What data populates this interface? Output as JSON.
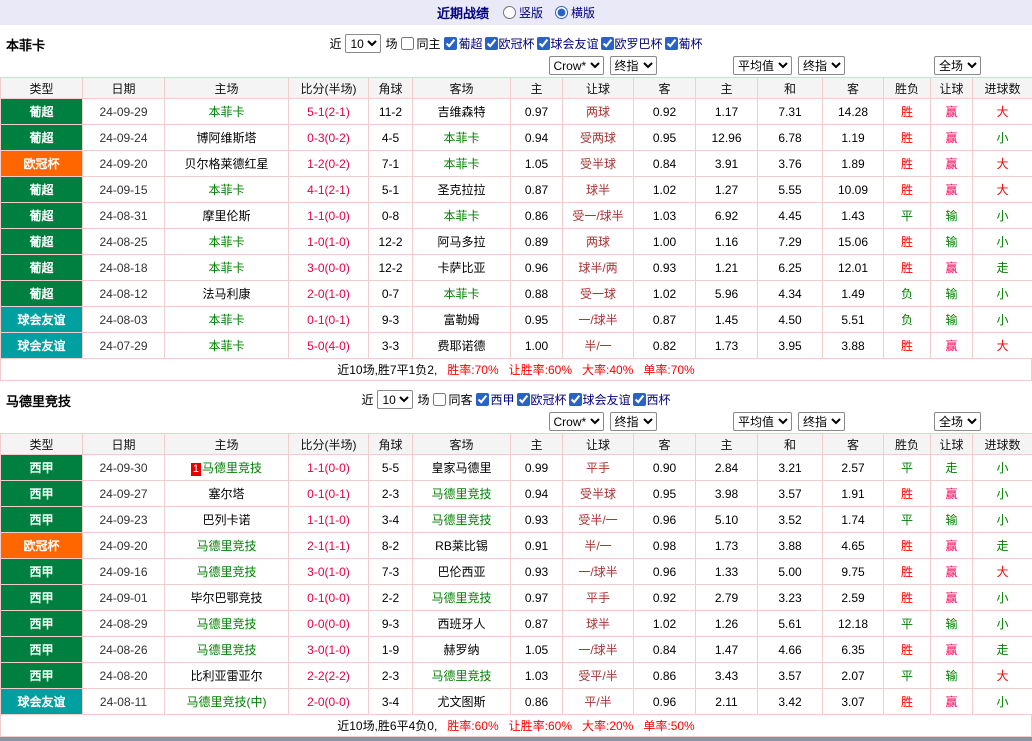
{
  "topbar": {
    "title": "近期战绩",
    "radios": [
      {
        "label": "竖版",
        "selected": false
      },
      {
        "label": "横版",
        "selected": true
      }
    ]
  },
  "colors": {
    "topbar_bg": "#e9e9f8",
    "accent_navy": "#000080",
    "focal_team": "#008000",
    "score": "#e60044",
    "handicap": "#aa3333",
    "border": "#f3cdcd",
    "summary_stat": "#ff0000"
  },
  "league_colors": {
    "葡超": "#008040",
    "欧冠杯": "#ff6600",
    "球会友谊": "#00a0a0",
    "西甲": "#008040"
  },
  "outcome_colors": {
    "胜": "#ff0000",
    "平": "#008000",
    "负": "#008000",
    "赢": "#ff0055",
    "输": "#008000",
    "走": "#008000",
    "大": "#ff0000",
    "小": "#008000"
  },
  "sections": [
    {
      "team": "本菲卡",
      "filter": {
        "near_label": "近",
        "count": "10",
        "games_label": "场",
        "same_label": "同主",
        "leagues": [
          "葡超",
          "欧冠杯",
          "球会友谊",
          "欧罗巴杯",
          "葡杯"
        ]
      },
      "dropdowns": {
        "odds_company": "Crow*",
        "odds_time": "终指",
        "average": "平均值",
        "average_time": "终指",
        "scope": "全场"
      },
      "headers": [
        "类型",
        "日期",
        "主场",
        "比分(半场)",
        "角球",
        "客场",
        "主",
        "让球",
        "客",
        "主",
        "和",
        "客",
        "胜负",
        "让球",
        "进球数"
      ],
      "rows": [
        {
          "league": "葡超",
          "date": "24-09-29",
          "home": "本菲卡",
          "score": "5-1(2-1)",
          "corners": "11-2",
          "away": "吉维森特",
          "focal": "home",
          "odds": [
            "0.97",
            "两球",
            "0.92"
          ],
          "avg": [
            "1.17",
            "7.31",
            "14.28"
          ],
          "outcome": [
            "胜",
            "赢",
            "大"
          ]
        },
        {
          "league": "葡超",
          "date": "24-09-24",
          "home": "博阿维斯塔",
          "score": "0-3(0-2)",
          "corners": "4-5",
          "away": "本菲卡",
          "focal": "away",
          "odds": [
            "0.94",
            "受两球",
            "0.95"
          ],
          "avg": [
            "12.96",
            "6.78",
            "1.19"
          ],
          "outcome": [
            "胜",
            "赢",
            "小"
          ]
        },
        {
          "league": "欧冠杯",
          "date": "24-09-20",
          "home": "贝尔格莱德红星",
          "score": "1-2(0-2)",
          "corners": "7-1",
          "away": "本菲卡",
          "focal": "away",
          "odds": [
            "1.05",
            "受半球",
            "0.84"
          ],
          "avg": [
            "3.91",
            "3.76",
            "1.89"
          ],
          "outcome": [
            "胜",
            "赢",
            "大"
          ]
        },
        {
          "league": "葡超",
          "date": "24-09-15",
          "home": "本菲卡",
          "score": "4-1(2-1)",
          "corners": "5-1",
          "away": "圣克拉拉",
          "focal": "home",
          "odds": [
            "0.87",
            "球半",
            "1.02"
          ],
          "avg": [
            "1.27",
            "5.55",
            "10.09"
          ],
          "outcome": [
            "胜",
            "赢",
            "大"
          ]
        },
        {
          "league": "葡超",
          "date": "24-08-31",
          "home": "摩里伦斯",
          "score": "1-1(0-0)",
          "corners": "0-8",
          "away": "本菲卡",
          "focal": "away",
          "odds": [
            "0.86",
            "受一/球半",
            "1.03"
          ],
          "avg": [
            "6.92",
            "4.45",
            "1.43"
          ],
          "outcome": [
            "平",
            "输",
            "小"
          ]
        },
        {
          "league": "葡超",
          "date": "24-08-25",
          "home": "本菲卡",
          "score": "1-0(1-0)",
          "corners": "12-2",
          "away": "阿马多拉",
          "focal": "home",
          "odds": [
            "0.89",
            "两球",
            "1.00"
          ],
          "avg": [
            "1.16",
            "7.29",
            "15.06"
          ],
          "outcome": [
            "胜",
            "输",
            "小"
          ]
        },
        {
          "league": "葡超",
          "date": "24-08-18",
          "home": "本菲卡",
          "score": "3-0(0-0)",
          "corners": "12-2",
          "away": "卡萨比亚",
          "focal": "home",
          "odds": [
            "0.96",
            "球半/两",
            "0.93"
          ],
          "avg": [
            "1.21",
            "6.25",
            "12.01"
          ],
          "outcome": [
            "胜",
            "赢",
            "走"
          ]
        },
        {
          "league": "葡超",
          "date": "24-08-12",
          "home": "法马利康",
          "score": "2-0(1-0)",
          "corners": "0-7",
          "away": "本菲卡",
          "focal": "away",
          "odds": [
            "0.88",
            "受一球",
            "1.02"
          ],
          "avg": [
            "5.96",
            "4.34",
            "1.49"
          ],
          "outcome": [
            "负",
            "输",
            "小"
          ]
        },
        {
          "league": "球会友谊",
          "date": "24-08-03",
          "home": "本菲卡",
          "score": "0-1(0-1)",
          "corners": "9-3",
          "away": "富勒姆",
          "focal": "home",
          "odds": [
            "0.95",
            "一/球半",
            "0.87"
          ],
          "avg": [
            "1.45",
            "4.50",
            "5.51"
          ],
          "outcome": [
            "负",
            "输",
            "小"
          ]
        },
        {
          "league": "球会友谊",
          "date": "24-07-29",
          "home": "本菲卡",
          "score": "5-0(4-0)",
          "corners": "3-3",
          "away": "费耶诺德",
          "focal": "home",
          "odds": [
            "1.00",
            "半/一",
            "0.82"
          ],
          "avg": [
            "1.73",
            "3.95",
            "3.88"
          ],
          "outcome": [
            "胜",
            "赢",
            "大"
          ]
        }
      ],
      "summary": {
        "prefix": "近10场,胜7平1负2,",
        "stats": [
          "胜率:70%",
          "让胜率:60%",
          "大率:40%",
          "单率:70%"
        ]
      }
    },
    {
      "team": "马德里竞技",
      "filter": {
        "near_label": "近",
        "count": "10",
        "games_label": "场",
        "same_label": "同客",
        "leagues": [
          "西甲",
          "欧冠杯",
          "球会友谊",
          "西杯"
        ]
      },
      "dropdowns": {
        "odds_company": "Crow*",
        "odds_time": "终指",
        "average": "平均值",
        "average_time": "终指",
        "scope": "全场"
      },
      "headers": [
        "类型",
        "日期",
        "主场",
        "比分(半场)",
        "角球",
        "客场",
        "主",
        "让球",
        "客",
        "主",
        "和",
        "客",
        "胜负",
        "让球",
        "进球数"
      ],
      "rows": [
        {
          "league": "西甲",
          "date": "24-09-30",
          "home": "马德里竞技",
          "home_badge": "1",
          "score": "1-1(0-0)",
          "corners": "5-5",
          "away": "皇家马德里",
          "focal": "home",
          "odds": [
            "0.99",
            "平手",
            "0.90"
          ],
          "avg": [
            "2.84",
            "3.21",
            "2.57"
          ],
          "outcome": [
            "平",
            "走",
            "小"
          ]
        },
        {
          "league": "西甲",
          "date": "24-09-27",
          "home": "塞尔塔",
          "score": "0-1(0-1)",
          "corners": "2-3",
          "away": "马德里竞技",
          "focal": "away",
          "odds": [
            "0.94",
            "受半球",
            "0.95"
          ],
          "avg": [
            "3.98",
            "3.57",
            "1.91"
          ],
          "outcome": [
            "胜",
            "赢",
            "小"
          ]
        },
        {
          "league": "西甲",
          "date": "24-09-23",
          "home": "巴列卡诺",
          "score": "1-1(1-0)",
          "corners": "3-4",
          "away": "马德里竞技",
          "focal": "away",
          "odds": [
            "0.93",
            "受半/一",
            "0.96"
          ],
          "avg": [
            "5.10",
            "3.52",
            "1.74"
          ],
          "outcome": [
            "平",
            "输",
            "小"
          ]
        },
        {
          "league": "欧冠杯",
          "date": "24-09-20",
          "home": "马德里竞技",
          "score": "2-1(1-1)",
          "corners": "8-2",
          "away": "RB莱比锡",
          "focal": "home",
          "odds": [
            "0.91",
            "半/一",
            "0.98"
          ],
          "avg": [
            "1.73",
            "3.88",
            "4.65"
          ],
          "outcome": [
            "胜",
            "赢",
            "走"
          ]
        },
        {
          "league": "西甲",
          "date": "24-09-16",
          "home": "马德里竞技",
          "score": "3-0(1-0)",
          "corners": "7-3",
          "away": "巴伦西亚",
          "focal": "home",
          "odds": [
            "0.93",
            "一/球半",
            "0.96"
          ],
          "avg": [
            "1.33",
            "5.00",
            "9.75"
          ],
          "outcome": [
            "胜",
            "赢",
            "大"
          ]
        },
        {
          "league": "西甲",
          "date": "24-09-01",
          "home": "毕尔巴鄂竞技",
          "score": "0-1(0-0)",
          "corners": "2-2",
          "away": "马德里竞技",
          "focal": "away",
          "odds": [
            "0.97",
            "平手",
            "0.92"
          ],
          "avg": [
            "2.79",
            "3.23",
            "2.59"
          ],
          "outcome": [
            "胜",
            "赢",
            "小"
          ]
        },
        {
          "league": "西甲",
          "date": "24-08-29",
          "home": "马德里竞技",
          "score": "0-0(0-0)",
          "corners": "9-3",
          "away": "西班牙人",
          "focal": "home",
          "odds": [
            "0.87",
            "球半",
            "1.02"
          ],
          "avg": [
            "1.26",
            "5.61",
            "12.18"
          ],
          "outcome": [
            "平",
            "输",
            "小"
          ]
        },
        {
          "league": "西甲",
          "date": "24-08-26",
          "home": "马德里竞技",
          "score": "3-0(1-0)",
          "corners": "1-9",
          "away": "赫罗纳",
          "focal": "home",
          "odds": [
            "1.05",
            "一/球半",
            "0.84"
          ],
          "avg": [
            "1.47",
            "4.66",
            "6.35"
          ],
          "outcome": [
            "胜",
            "赢",
            "走"
          ]
        },
        {
          "league": "西甲",
          "date": "24-08-20",
          "home": "比利亚雷亚尔",
          "score": "2-2(2-2)",
          "corners": "2-3",
          "away": "马德里竞技",
          "focal": "away",
          "odds": [
            "1.03",
            "受平/半",
            "0.86"
          ],
          "avg": [
            "3.43",
            "3.57",
            "2.07"
          ],
          "outcome": [
            "平",
            "输",
            "大"
          ]
        },
        {
          "league": "球会友谊",
          "date": "24-08-11",
          "home": "马德里竞技(中)",
          "score": "2-0(0-0)",
          "corners": "3-4",
          "away": "尤文图斯",
          "focal": "home",
          "odds": [
            "0.86",
            "平/半",
            "0.96"
          ],
          "avg": [
            "2.11",
            "3.42",
            "3.07"
          ],
          "outcome": [
            "胜",
            "赢",
            "小"
          ]
        }
      ],
      "summary": {
        "prefix": "近10场,胜6平4负0,",
        "stats": [
          "胜率:60%",
          "让胜率:60%",
          "大率:20%",
          "单率:50%"
        ]
      }
    }
  ]
}
